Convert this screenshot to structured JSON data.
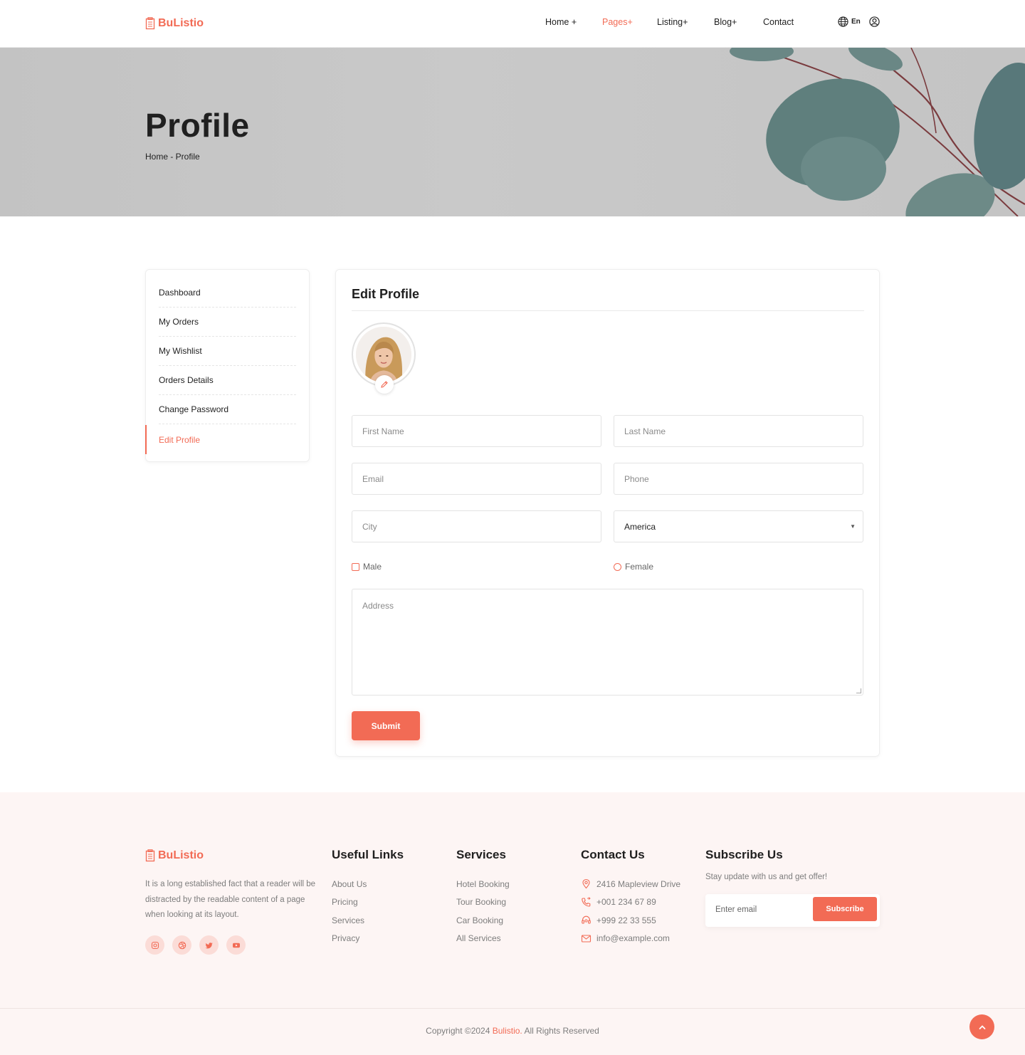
{
  "header": {
    "brand": "BuListio",
    "nav": [
      "Home +",
      "Pages+",
      "Listing+",
      "Blog+",
      "Contact"
    ],
    "lang": "En"
  },
  "hero": {
    "title": "Profile",
    "breadcrumb": "Home - Profile"
  },
  "sidebar": {
    "items": [
      {
        "label": "Dashboard"
      },
      {
        "label": "My Orders"
      },
      {
        "label": "My Wishlist"
      },
      {
        "label": "Orders Details"
      },
      {
        "label": "Change Password"
      },
      {
        "label": "Edit Profile"
      }
    ]
  },
  "form": {
    "title": "Edit Profile",
    "first_name": "First Name",
    "last_name": "Last Name",
    "email": "Email",
    "phone": "Phone",
    "city": "City",
    "country": "America",
    "gender_male": "Male",
    "gender_female": "Female",
    "address": "Address",
    "submit": "Submit"
  },
  "footer": {
    "brand": "BuListio",
    "description": "It is a long established fact that a reader will be distracted by the readable content of a page when looking at its layout.",
    "useful_links": {
      "title": "Useful Links",
      "items": [
        "About Us",
        "Pricing",
        "Services",
        "Privacy"
      ]
    },
    "services": {
      "title": "Services",
      "items": [
        "Hotel Booking",
        "Tour Booking",
        "Car Booking",
        "All Services"
      ]
    },
    "contact": {
      "title": "Contact Us",
      "address": "2416 Mapleview Drive",
      "phone1": "+001 234 67 89",
      "phone2": "+999 22 33 555",
      "email": "info@example.com"
    },
    "subscribe": {
      "title": "Subscribe Us",
      "text": "Stay update with us and get offer!",
      "placeholder": "Enter email",
      "button": "Subscribe"
    },
    "copyright_prefix": "Copyright ©2024 ",
    "copyright_brand": "Bulistio.",
    "copyright_suffix": " All Rights Reserved"
  },
  "colors": {
    "accent": "#f26b55",
    "footer_bg": "#fdf5f4"
  }
}
